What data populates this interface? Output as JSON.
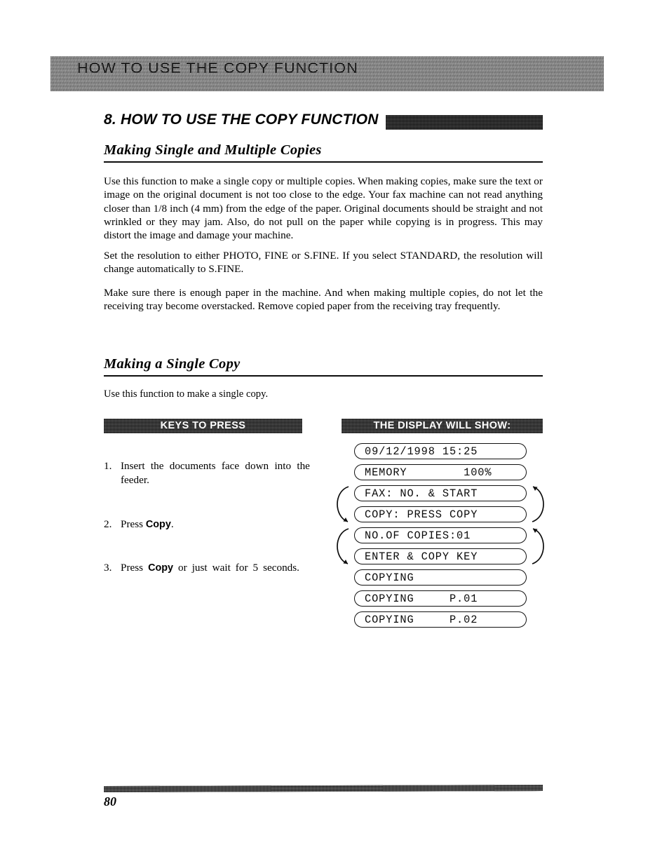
{
  "running_header": {
    "text": "HOW TO USE THE COPY FUNCTION"
  },
  "chapter": {
    "title": "8. HOW TO USE THE COPY FUNCTION"
  },
  "sections": {
    "multiple": {
      "heading": "Making Single and Multiple Copies",
      "paragraphs": [
        "Use this function to make a single copy or multiple copies. When making copies, make sure the text or image on the original document is not too close to the edge. Your fax machine can not read anything closer than 1/8 inch (4 mm) from the edge of the paper. Original documents should be straight and not wrinkled or they may jam. Also, do not pull on the paper while copying is in progress. This may distort the image and damage your machine.",
        "Set the resolution to either PHOTO, FINE or S.FINE. If you select STANDARD, the resolution will change automatically to S.FINE.",
        "Make sure there is enough paper in the machine. And when making multiple copies, do not let the receiving tray become overstacked. Remove copied paper from the receiving tray frequently."
      ]
    },
    "single": {
      "heading": "Making a Single Copy",
      "intro": "Use this function to make a single copy."
    }
  },
  "columns": {
    "keys_banner": "KEYS TO PRESS",
    "display_banner": "THE DISPLAY WILL SHOW:"
  },
  "steps": [
    {
      "number": "1.",
      "text_before": "Insert the documents face down into the feeder.",
      "bold": "",
      "text_after": ""
    },
    {
      "number": "2.",
      "text_before": "Press ",
      "bold": "Copy",
      "text_after": "."
    },
    {
      "number": "3.",
      "text_before": "Press ",
      "bold": "Copy",
      "text_after": " or just wait for 5 seconds."
    }
  ],
  "display_lines": [
    {
      "text": "09/12/1998 15:25"
    },
    {
      "text": "MEMORY        100%"
    },
    {
      "text": "FAX: NO. & START"
    },
    {
      "text": "COPY: PRESS COPY"
    },
    {
      "text": "NO.OF COPIES:01"
    },
    {
      "text": "ENTER & COPY KEY"
    },
    {
      "text": "COPYING"
    },
    {
      "text": "COPYING     P.01"
    },
    {
      "text": "COPYING     P.02"
    }
  ],
  "footer": {
    "page_number": "80"
  },
  "colors": {
    "ink": "#000000",
    "paper": "#ffffff",
    "banner_dark": "#232323",
    "header_band": "#9a9a9a"
  }
}
